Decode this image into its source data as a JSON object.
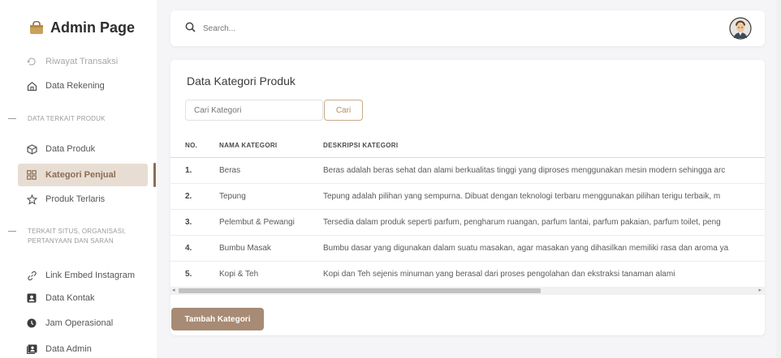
{
  "app": {
    "title": "Admin Page"
  },
  "sidebar": {
    "items_top": [
      {
        "label": "Riwayat Transaksi",
        "icon": "history-icon"
      },
      {
        "label": "Data Rekening",
        "icon": "home-icon"
      }
    ],
    "section1": "DATA TERKAIT PRODUK",
    "items_produk": [
      {
        "label": "Data Produk",
        "icon": "box-icon"
      },
      {
        "label": "Kategori Penjual",
        "icon": "grid-icon"
      },
      {
        "label": "Produk Terlaris",
        "icon": "star-icon"
      }
    ],
    "section2_line1": "TERKAIT SITUS, ORGANISASI,",
    "section2_line2": "PERTANYAAN DAN SARAN",
    "items_situs": [
      {
        "label": "Link Embed Instagram",
        "icon": "link-icon"
      },
      {
        "label": "Data Kontak",
        "icon": "contact-icon"
      },
      {
        "label": "Jam Operasional",
        "icon": "clock-icon"
      },
      {
        "label": "Data Admin",
        "icon": "admin-icon"
      }
    ]
  },
  "search": {
    "placeholder": "Search..."
  },
  "card": {
    "title": "Data Kategori Produk",
    "filter_placeholder": "Cari Kategori",
    "filter_button": "Cari",
    "columns": [
      "NO.",
      "NAMA KATEGORI",
      "DESKRIPSI KATEGORI"
    ],
    "rows": [
      {
        "no": "1.",
        "nama": "Beras",
        "deskripsi": "Beras adalah beras sehat dan alami berkualitas tinggi yang diproses menggunakan mesin modern sehingga arc"
      },
      {
        "no": "2.",
        "nama": "Tepung",
        "deskripsi": "Tepung adalah pilihan yang sempurna. Dibuat dengan teknologi terbaru menggunakan pilihan terigu terbaik, m"
      },
      {
        "no": "3.",
        "nama": "Pelembut & Pewangi",
        "deskripsi": "Tersedia dalam produk seperti parfum, pengharum ruangan, parfum lantai, parfum pakaian, parfum toilet, peng"
      },
      {
        "no": "4.",
        "nama": "Bumbu Masak",
        "deskripsi": "Bumbu dasar yang digunakan dalam suatu masakan, agar masakan yang dihasilkan memiliki rasa dan aroma ya"
      },
      {
        "no": "5.",
        "nama": "Kopi & Teh",
        "deskripsi": "Kopi dan Teh sejenis minuman yang berasal dari proses pengolahan dan ekstraksi tanaman alami"
      }
    ],
    "add_button": "Tambah Kategori"
  },
  "colors": {
    "accent": "#a78b74",
    "active_bg": "#e8ddd2",
    "active_text": "#8a6d55"
  }
}
